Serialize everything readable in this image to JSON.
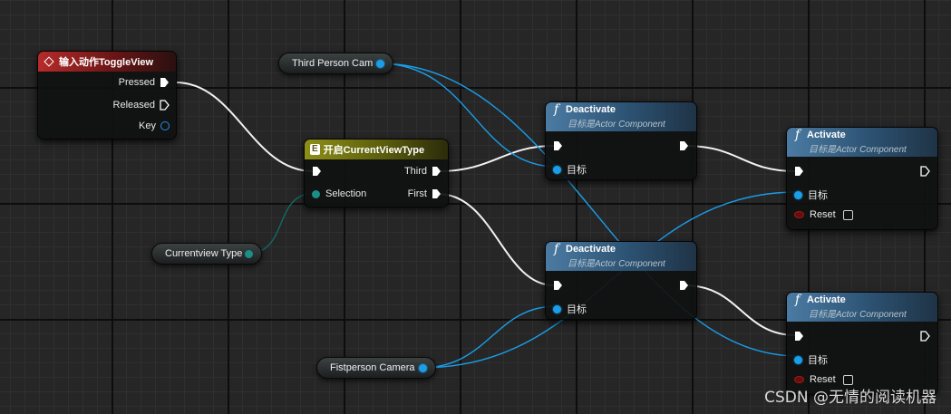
{
  "event_node": {
    "title": "输入动作ToggleView",
    "pins": {
      "pressed": "Pressed",
      "released": "Released",
      "key": "Key"
    }
  },
  "switch_node": {
    "title": "开启CurrentViewType",
    "pins": {
      "exec_in": "",
      "selection": "Selection",
      "third": "Third",
      "first": "First"
    }
  },
  "deactivate_1": {
    "title": "Deactivate",
    "subtitle": "目标是Actor Component",
    "target": "目标"
  },
  "deactivate_2": {
    "title": "Deactivate",
    "subtitle": "目标是Actor Component",
    "target": "目标"
  },
  "activate_1": {
    "title": "Activate",
    "subtitle": "目标是Actor Component",
    "target": "目标",
    "reset": "Reset"
  },
  "activate_2": {
    "title": "Activate",
    "subtitle": "目标是Actor Component",
    "target": "目标",
    "reset": "Reset"
  },
  "variables": {
    "third_person_cam": "Third Person Cam",
    "currentview_type": "Currentview Type",
    "fistperson_camera": "Fistperson Camera"
  },
  "watermark": "CSDN @无情的阅读机器",
  "colors": {
    "exec_wire": "#ffffff",
    "object_wire": "#1a9ee8",
    "enum_wire": "#0f6b66"
  }
}
